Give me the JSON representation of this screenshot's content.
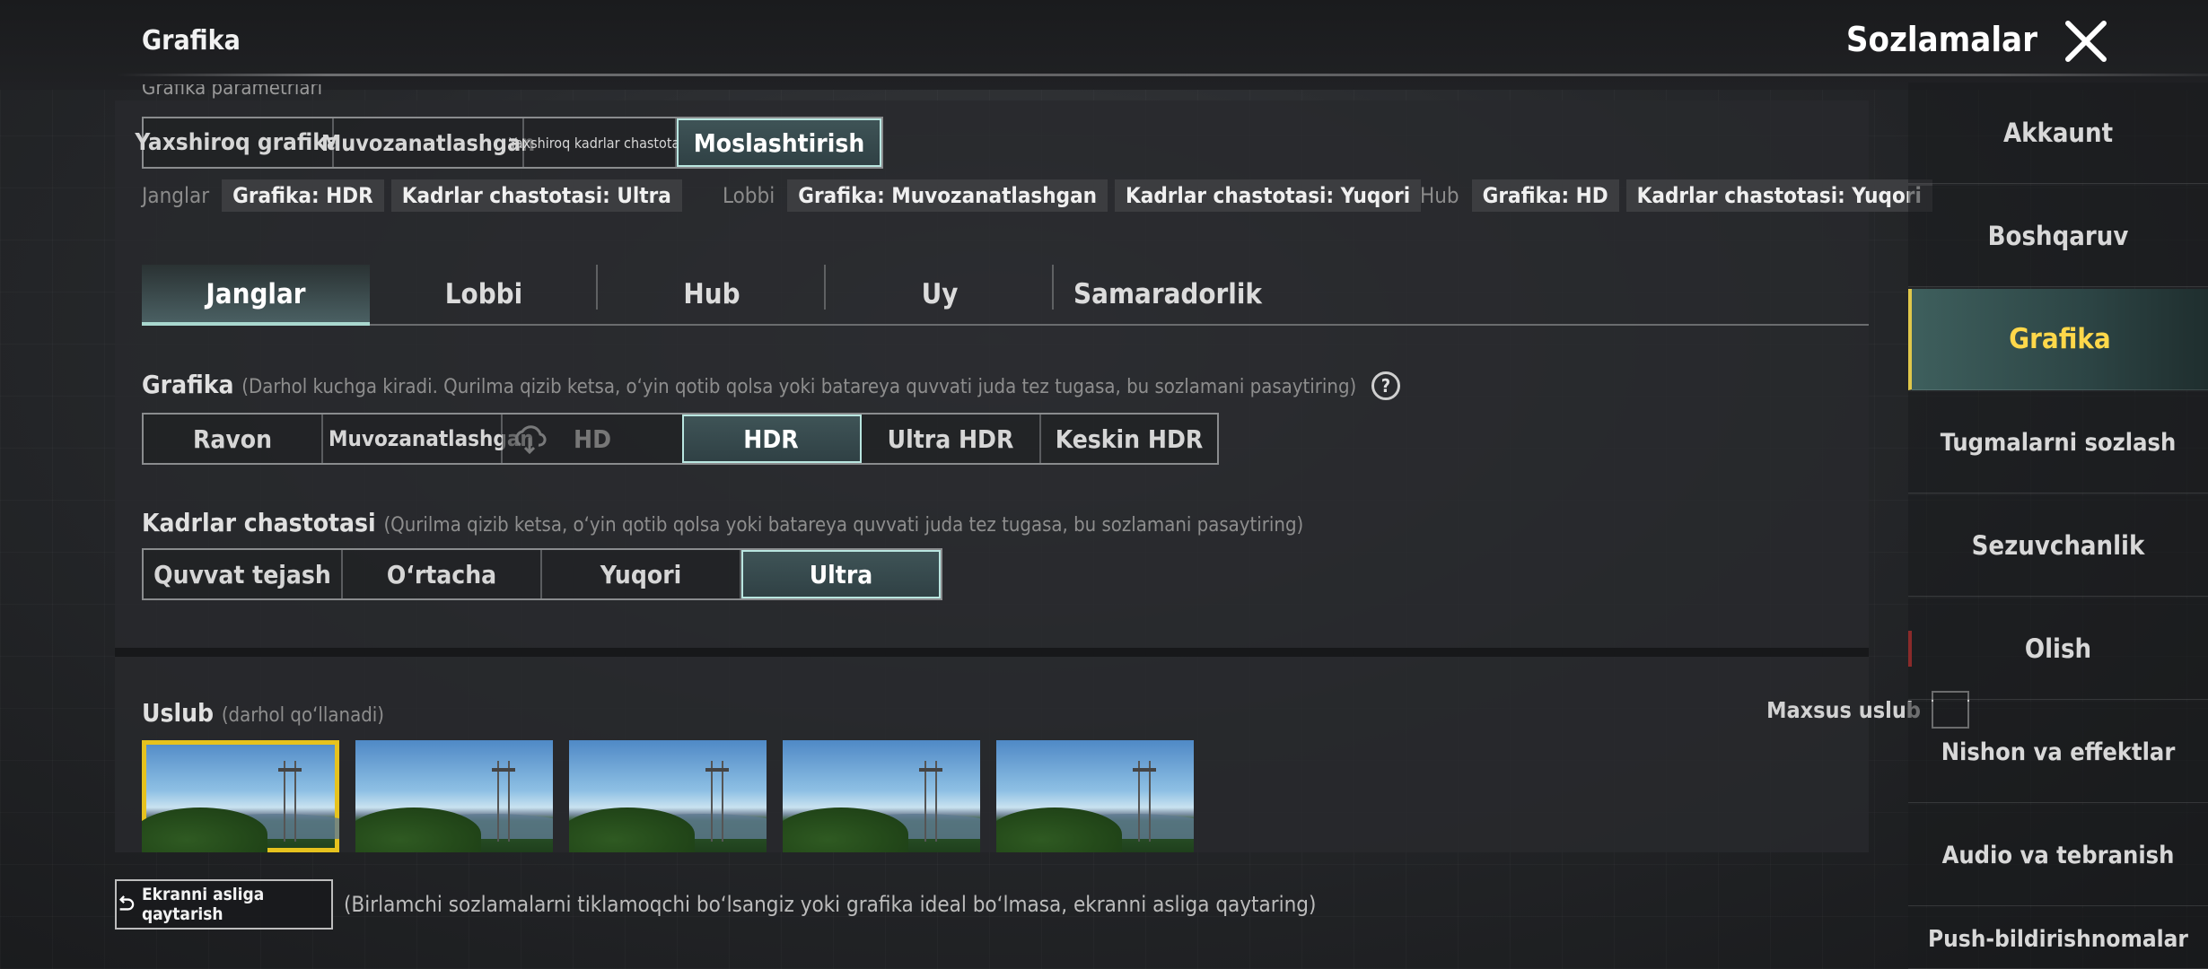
{
  "header": {
    "page_title": "Grafika",
    "settings_title": "Sozlamalar"
  },
  "presets": {
    "cut_label": "Grafika parametrlari",
    "options": [
      "Yaxshiroq grafika",
      "Muvozanatlashgan",
      "Yaxshiroq kadrlar chastotasi",
      "Moslashtirish"
    ],
    "selected": "Moslashtirish",
    "info": [
      {
        "label": "Janglar",
        "tags": [
          "Grafika: HDR",
          "Kadrlar chastotasi: Ultra"
        ]
      },
      {
        "label": "Lobbi",
        "tags": [
          "Grafika: Muvozanatlashgan",
          "Kadrlar chastotasi: Yuqori"
        ]
      },
      {
        "label": "Hub",
        "tags": [
          "Grafika: HD",
          "Kadrlar chastotasi: Yuqori"
        ]
      }
    ]
  },
  "tabs": [
    "Janglar",
    "Lobbi",
    "Hub",
    "Uy",
    "Samaradorlik"
  ],
  "active_tab": "Janglar",
  "graphics": {
    "label": "Grafika",
    "note": "(Darhol kuchga kiradi. Qurilma qizib ketsa, o‘yin qotib qolsa yoki batareya quvvati juda tez tugasa, bu sozlamani pasaytiring)",
    "options": [
      "Ravon",
      "Muvozanatlashgan",
      "HD",
      "HDR",
      "Ultra HDR",
      "Keskin HDR"
    ],
    "selected": "HDR"
  },
  "framerate": {
    "label": "Kadrlar chastotasi",
    "note": "(Qurilma qizib ketsa, o‘yin qotib qolsa yoki batareya quvvati juda tez tugasa, bu sozlamani pasaytiring)",
    "options": [
      "Quvvat tejash",
      "O‘rtacha",
      "Yuqori",
      "Ultra"
    ],
    "selected": "Ultra"
  },
  "style": {
    "label": "Uslub",
    "note": "(darhol qo‘llanadi)",
    "custom_label": "Maxsus uslub",
    "custom_checked": false,
    "thumbnails_count": 5,
    "selected_index": 0
  },
  "reset": {
    "button_label": "Ekranni asliga qaytarish",
    "note": "(Birlamchi sozlamalarni tiklamoqchi bo‘lsangiz yoki grafika ideal bo‘lmasa, ekranni asliga qaytaring)"
  },
  "sidebar": {
    "items": [
      "Akkaunt",
      "Boshqaruv",
      "Grafika",
      "Tugmalarni sozlash",
      "Sezuvchanlik",
      "Olish",
      "Nishon va effektlar",
      "Audio va tebranish",
      "Push-bildirishnomalar"
    ],
    "active": "Grafika"
  },
  "colors": {
    "accent_teal": "#b9e6e0",
    "active_yellow": "#ffd84a",
    "selected_thumb": "#e6c21e"
  }
}
